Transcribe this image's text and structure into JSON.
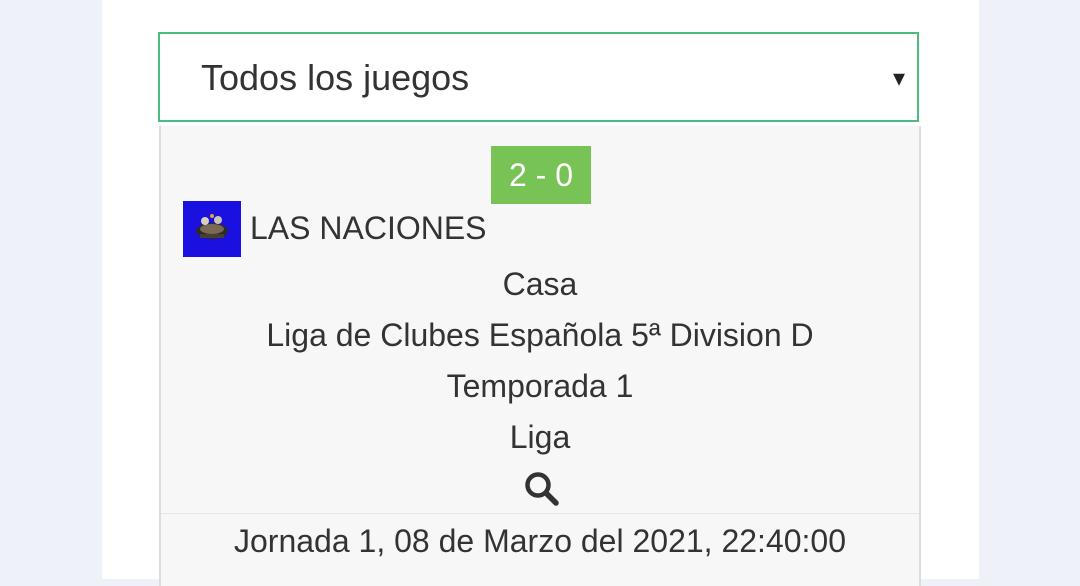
{
  "filter": {
    "selected_label": "Todos los juegos",
    "caret_glyph": "▾"
  },
  "match": {
    "score": "2 - 0",
    "team_name": "LAS NACIONES",
    "venue": "Casa",
    "league": "Liga de Clubes Española 5ª Division D",
    "season": "Temporada 1",
    "competition_type": "Liga",
    "details_icon": "search-icon",
    "date_line": "Jornada 1, 08 de Marzo del 2021, 22:40:00"
  },
  "colors": {
    "select_border": "#4cbb7f",
    "score_badge": "#78c356",
    "team_logo_bg": "#1a10e0",
    "card_bg": "#f7f7f7",
    "page_bg": "#eef1f7"
  }
}
